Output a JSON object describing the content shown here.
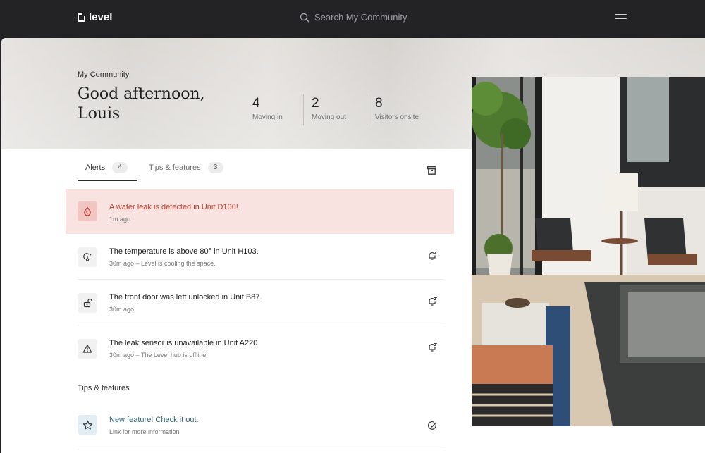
{
  "header": {
    "logo_text": "level",
    "search_placeholder": "Search My Community"
  },
  "hero": {
    "section_label": "My Community",
    "greeting_line1": "Good afternoon,",
    "greeting_line2": "Louis",
    "stats": [
      {
        "value": "4",
        "label": "Moving in"
      },
      {
        "value": "2",
        "label": "Moving out"
      },
      {
        "value": "8",
        "label": "Visitors onsite"
      }
    ]
  },
  "tabs": [
    {
      "label": "Alerts",
      "count": "4"
    },
    {
      "label": "Tips & features",
      "count": "3"
    }
  ],
  "alerts": [
    {
      "title": "A water leak is detected in Unit D106!",
      "meta": "1m ago",
      "icon": "water-drop-icon"
    },
    {
      "title": "The temperature is above 80° in Unit H103.",
      "meta": "30m ago – Level is cooling the space.",
      "icon": "temperature-icon"
    },
    {
      "title": "The front door was left unlocked in Unit B87.",
      "meta": "30m ago",
      "icon": "unlock-icon"
    },
    {
      "title": "The leak sensor is unavailable in Unit A220.",
      "meta": "30m ago – The Level hub is offline.",
      "icon": "warning-icon"
    }
  ],
  "tips_section": {
    "title": "Tips & features",
    "items": [
      {
        "title": "New feature! Check it out.",
        "meta": "Link for more information",
        "icon": "star-icon"
      }
    ]
  },
  "colors": {
    "topbar": "#232326",
    "alert_highlight": "#f8e3e1",
    "alert_text": "#c0392b",
    "tip_text": "#2f6473"
  }
}
